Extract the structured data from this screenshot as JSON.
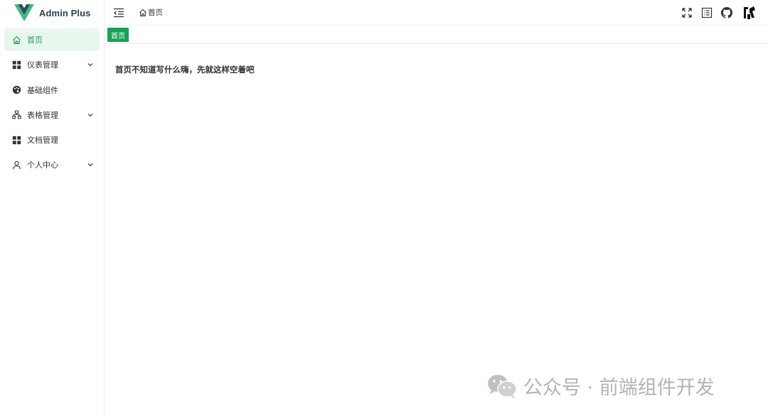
{
  "app": {
    "title": "Admin Plus"
  },
  "sidebar": {
    "items": [
      {
        "label": "首页",
        "icon": "home-icon",
        "active": true,
        "expandable": false
      },
      {
        "label": "仪表管理",
        "icon": "grid-icon",
        "active": false,
        "expandable": true
      },
      {
        "label": "基础组件",
        "icon": "palette-icon",
        "active": false,
        "expandable": false
      },
      {
        "label": "表格管理",
        "icon": "sitemap-icon",
        "active": false,
        "expandable": true
      },
      {
        "label": "文档管理",
        "icon": "grid-icon",
        "active": false,
        "expandable": false
      },
      {
        "label": "个人中心",
        "icon": "user-icon",
        "active": false,
        "expandable": true
      }
    ]
  },
  "header": {
    "breadcrumb": "首页",
    "icons": [
      "fullscreen-icon",
      "document-icon",
      "github-icon",
      "avatar"
    ]
  },
  "tags": [
    {
      "label": "首页",
      "active": true
    }
  ],
  "main": {
    "text": "首页不知道写什么嗨，先就这样空着吧"
  },
  "watermark": {
    "text": "公众号 · 前端组件开发"
  },
  "colors": {
    "accent": "#18a058",
    "active_bg": "#e9f6ee",
    "text": "#303133",
    "border": "#ececec"
  }
}
